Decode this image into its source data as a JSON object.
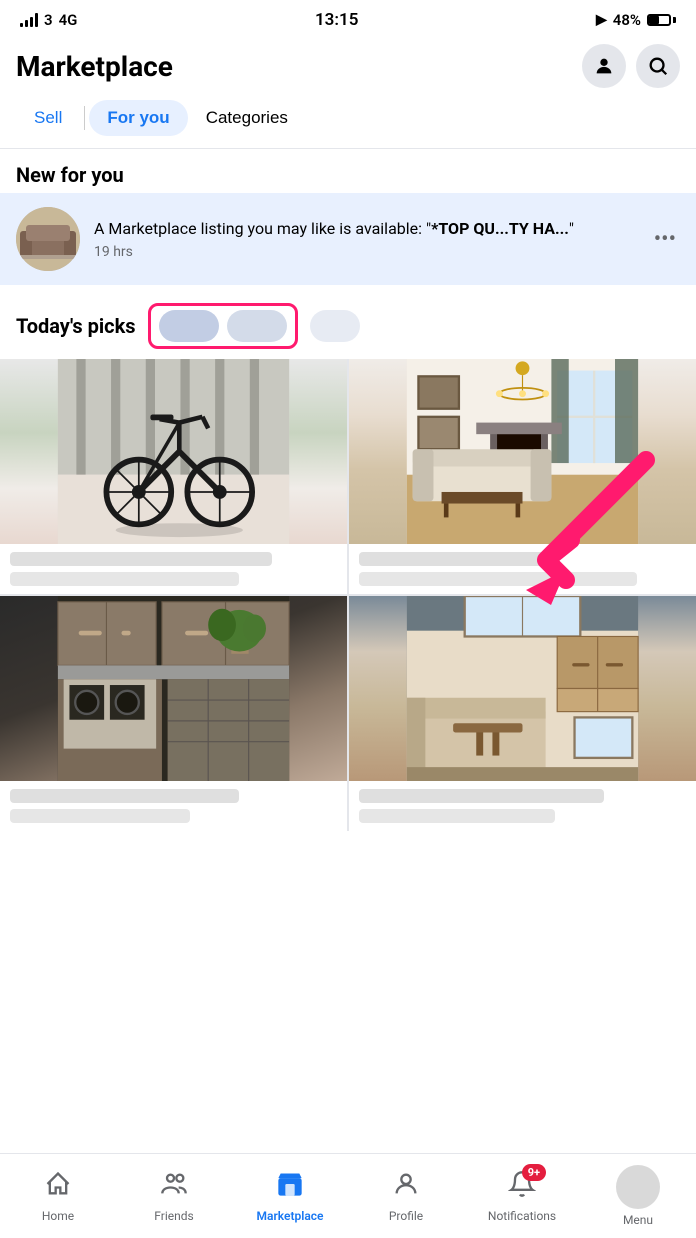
{
  "statusBar": {
    "carrier": "3",
    "network": "4G",
    "time": "13:15",
    "battery": "48%",
    "batteryFill": 48
  },
  "header": {
    "title": "Marketplace",
    "profileIcon": "person",
    "searchIcon": "search"
  },
  "tabs": [
    {
      "id": "sell",
      "label": "Sell",
      "active": false
    },
    {
      "id": "for-you",
      "label": "For you",
      "active": true
    },
    {
      "id": "categories",
      "label": "Categories",
      "active": false
    }
  ],
  "notification": {
    "text": "A Marketplace listing you may like is available: \"*TOP QU...TY HA...",
    "time": "19 hrs"
  },
  "sections": {
    "newForYou": "New for you",
    "todaysPicks": "Today's picks"
  },
  "bottomNav": [
    {
      "id": "home",
      "label": "Home",
      "active": false
    },
    {
      "id": "friends",
      "label": "Friends",
      "active": false
    },
    {
      "id": "marketplace",
      "label": "Marketplace",
      "active": true
    },
    {
      "id": "profile",
      "label": "Profile",
      "active": false
    },
    {
      "id": "notifications",
      "label": "Notifications",
      "active": false,
      "badge": "9+"
    },
    {
      "id": "menu",
      "label": "Menu",
      "active": false
    }
  ],
  "colors": {
    "accent": "#1877f2",
    "pink": "#ff1a6e",
    "tabActiveBg": "#e7f0ff",
    "notifBg": "#e8f0fe"
  }
}
